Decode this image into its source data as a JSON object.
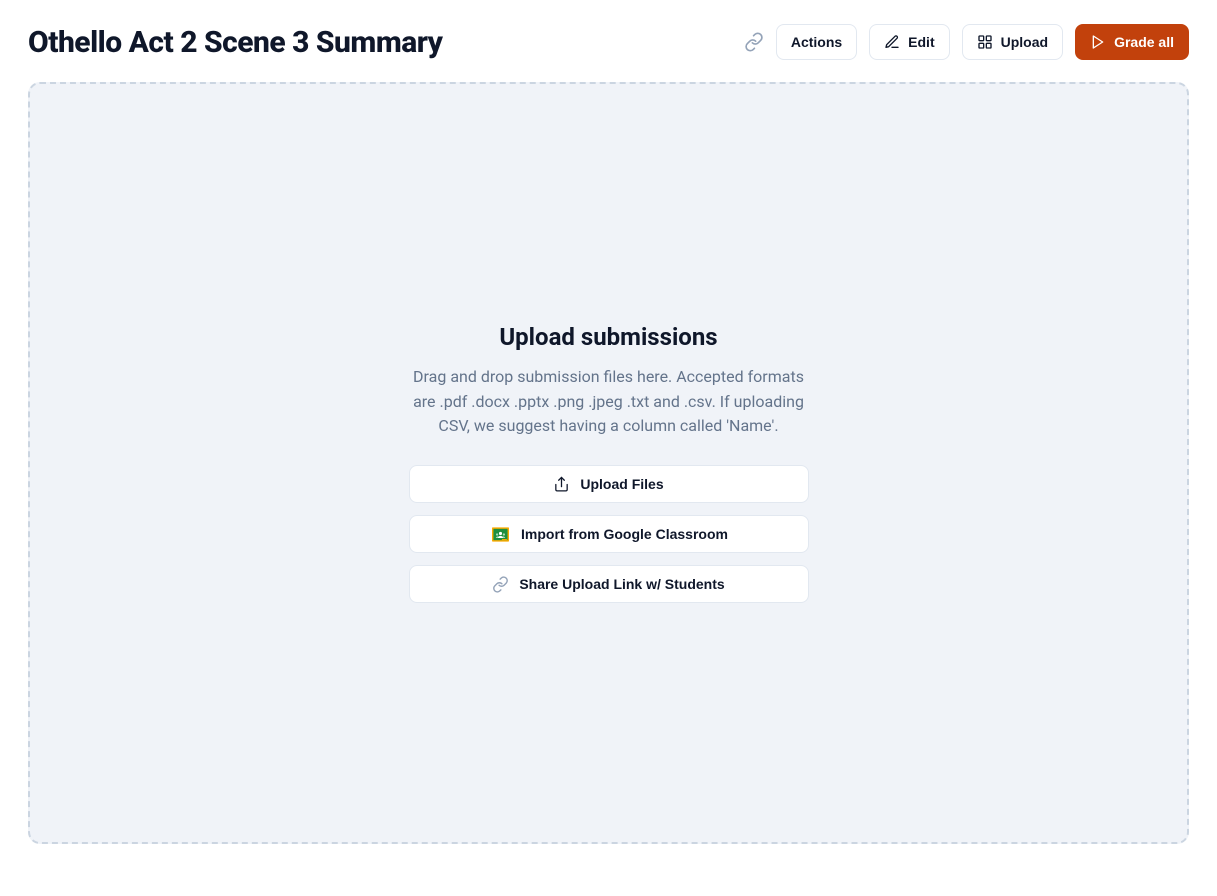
{
  "header": {
    "title": "Othello Act 2 Scene 3 Summary",
    "actions": {
      "link_icon_name": "link-icon",
      "actions_label": "Actions",
      "edit_label": "Edit",
      "upload_label": "Upload",
      "grade_all_label": "Grade all"
    }
  },
  "upload": {
    "heading": "Upload submissions",
    "description": "Drag and drop submission files here. Accepted formats are .pdf .docx .pptx .png .jpeg .txt and .csv. If uploading CSV, we suggest having a column called 'Name'.",
    "buttons": {
      "upload_files": "Upload Files",
      "import_google_classroom": "Import from Google Classroom",
      "share_link": "Share Upload Link w/ Students"
    }
  },
  "colors": {
    "primary": "#c2410c",
    "border": "#e2e8f0",
    "dropzone_bg": "#f0f3f8",
    "dashed_border": "#cbd5e1",
    "muted_text": "#64748b"
  }
}
